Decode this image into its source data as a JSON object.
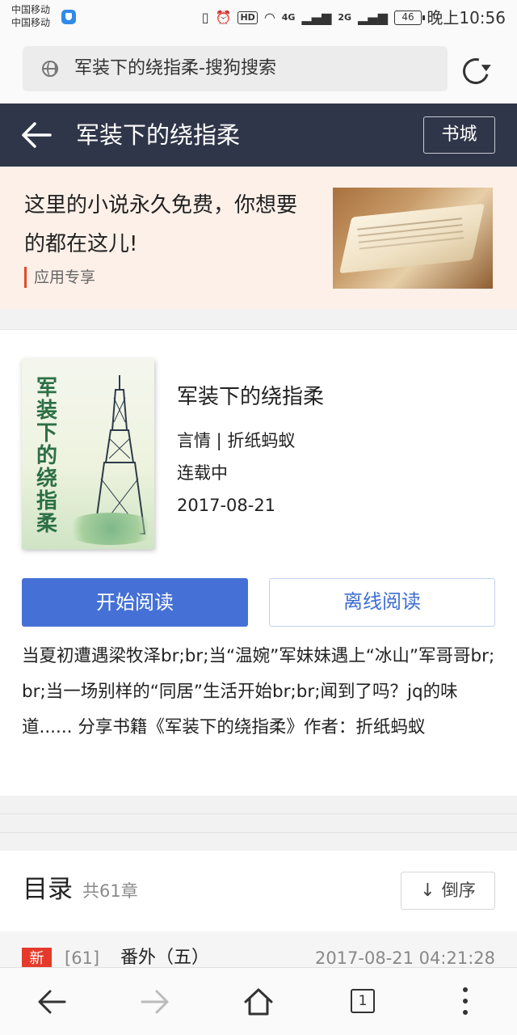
{
  "status_bar": {
    "carrier_1": "中国移动",
    "carrier_2": "中国移动",
    "hd": "HD",
    "net_4g": "4G",
    "net_2g": "2G",
    "battery": "46",
    "time": "晚上10:56"
  },
  "address_bar": {
    "url": "军装下的绕指柔-搜狗搜索"
  },
  "header": {
    "title": "军装下的绕指柔",
    "bookstore_label": "书城"
  },
  "banner": {
    "headline": "这里的小说永久免费，你想要的都在这儿!",
    "tag": "应用专享"
  },
  "book": {
    "cover_title": "军装下的绕指柔",
    "name": "军装下的绕指柔",
    "category_author": "言情 | 折纸蚂蚁",
    "status": "连载中",
    "date": "2017-08-21",
    "start_read_label": "开始阅读",
    "offline_read_label": "离线阅读",
    "synopsis": "当夏初遭遇梁牧泽br;br;当“温婉”军妹妹遇上“冰山”军哥哥br;br;当一场别样的“同居”生活开始br;br;闻到了吗？jq的味道...... 分享书籍《军装下的绕指柔》作者：折纸蚂蚁"
  },
  "toc": {
    "title": "目录",
    "count": "共61章",
    "sort_label": "倒序",
    "latest": {
      "badge": "新",
      "number": "[61]",
      "name": "番外（五）",
      "time": "2017-08-21 04:21:28"
    }
  },
  "bottom_nav": {
    "tab_count": "1"
  },
  "colors": {
    "header_bg": "#303649",
    "primary_button": "#4570d6",
    "banner_bg": "#fdf0e8",
    "new_badge": "#e53a2b"
  }
}
